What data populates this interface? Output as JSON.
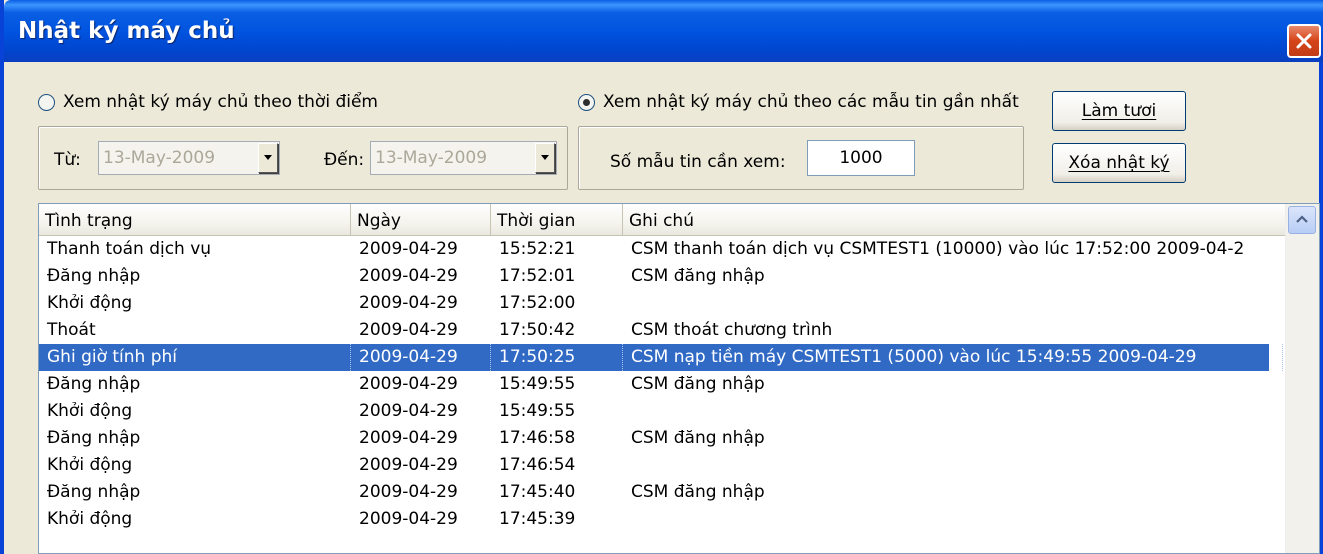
{
  "window": {
    "title": "Nhật ký máy chủ"
  },
  "filter": {
    "option_time": "Xem nhật ký máy chủ theo thời điểm",
    "option_recent": "Xem nhật ký máy chủ theo các mẫu tin gần nhất",
    "from_label": "Từ:",
    "from_value": "13-May-2009",
    "to_label": "Đến:",
    "to_value": "13-May-2009",
    "count_label": "Số mẫu tin cần xem:",
    "count_value": "1000",
    "selected_option": "recent"
  },
  "buttons": {
    "refresh": "Làm tươi",
    "clear": "Xóa nhật ký"
  },
  "table": {
    "columns": [
      "Tình trạng",
      "Ngày",
      "Thời gian",
      "Ghi chú"
    ],
    "selected_index": 4,
    "rows": [
      [
        "Thanh toán dịch vụ",
        "2009-04-29",
        "15:52:21",
        "CSM thanh toán dịch vụ  CSMTEST1 (10000) vào lúc 17:52:00  2009-04-2"
      ],
      [
        "Đăng nhập",
        "2009-04-29",
        "17:52:01",
        "CSM đăng nhập"
      ],
      [
        "Khởi động",
        "2009-04-29",
        "17:52:00",
        ""
      ],
      [
        "Thoát",
        "2009-04-29",
        "17:50:42",
        "CSM thoát chương trình"
      ],
      [
        "Ghi giờ tính phí",
        "2009-04-29",
        "17:50:25",
        "CSM nạp tiền máy CSMTEST1 (5000) vào lúc 15:49:55  2009-04-29"
      ],
      [
        "Đăng nhập",
        "2009-04-29",
        "15:49:55",
        "CSM đăng nhập"
      ],
      [
        "Khởi động",
        "2009-04-29",
        "15:49:55",
        ""
      ],
      [
        "Đăng nhập",
        "2009-04-29",
        "17:46:58",
        "CSM đăng nhập"
      ],
      [
        "Khởi động",
        "2009-04-29",
        "17:46:54",
        ""
      ],
      [
        "Đăng nhập",
        "2009-04-29",
        "17:45:40",
        "CSM đăng nhập"
      ],
      [
        "Khởi động",
        "2009-04-29",
        "17:45:39",
        ""
      ]
    ]
  },
  "colors": {
    "titlebar": "#0054e0",
    "selection": "#316ac5",
    "face": "#ece9d8"
  },
  "icons": {
    "close": "close-icon",
    "dropdown": "chevron-down-icon",
    "scroll_up": "scroll-up-icon"
  }
}
